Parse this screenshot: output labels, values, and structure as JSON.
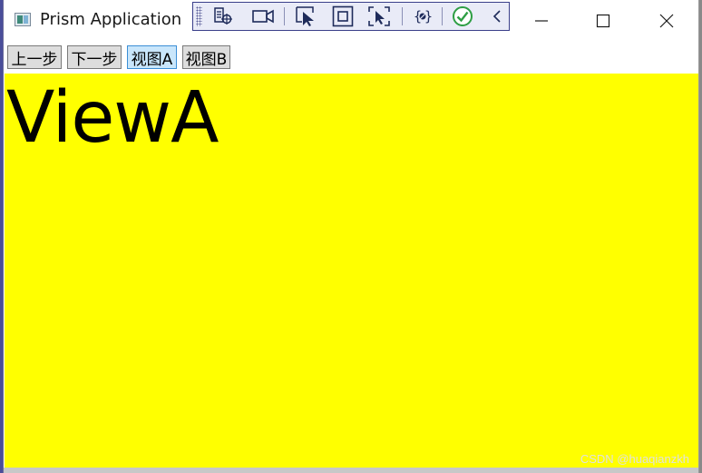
{
  "window": {
    "title": "Prism Application",
    "icon": "app-window-icon",
    "controls": [
      {
        "name": "minimize-button",
        "icon": "minimize-icon"
      },
      {
        "name": "maximize-button",
        "icon": "maximize-icon"
      },
      {
        "name": "close-button",
        "icon": "close-icon"
      }
    ]
  },
  "debug_toolbar": {
    "icons": [
      "live-visual-tree-icon",
      "video-camera-icon",
      "select-element-icon",
      "display-layout-adorners-icon",
      "track-focus-icon",
      "binding-failures-icon",
      "xaml-hot-reload-ok-icon",
      "collapse-toolbar-icon"
    ]
  },
  "navigation": {
    "buttons": [
      {
        "label": "上一步",
        "active": false
      },
      {
        "label": "下一步",
        "active": false
      },
      {
        "label": "视图A",
        "active": true
      },
      {
        "label": "视图B",
        "active": false
      }
    ]
  },
  "content": {
    "view_label": "ViewA",
    "background": "#ffff00"
  },
  "watermark": "CSDN @huaqianzkh",
  "colors": {
    "toolbar_bg": "#e9ebf7",
    "toolbar_border": "#3a3f8a",
    "active_button_bg": "#c9e6fb",
    "active_button_border": "#3c8fd6",
    "hot_reload_ok": "#2e9e44"
  }
}
